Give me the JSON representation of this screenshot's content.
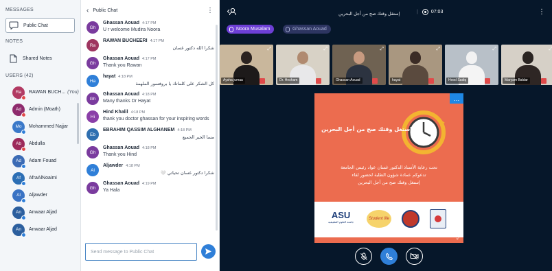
{
  "sidebar": {
    "messages_title": "MESSAGES",
    "public_chat_label": "Public Chat",
    "notes_title": "NOTES",
    "shared_notes_label": "Shared Notes",
    "users_title": "USERS (42)",
    "users": [
      {
        "initials": "Ra",
        "name": "RAWAN BUCH...",
        "suffix": "(You)",
        "color": "#b23a63",
        "badge": "#e04a4a"
      },
      {
        "initials": "Ad",
        "name": "Admin (Moath)",
        "suffix": "",
        "color": "#8e2b6d",
        "badge": "#e04a4a"
      },
      {
        "initials": "Mo",
        "name": "Mohammed Najjar",
        "suffix": "",
        "color": "#3b79c9",
        "badge": "#2f7fd8"
      },
      {
        "initials": "Ab",
        "name": "Abdulla",
        "suffix": "",
        "color": "#9d2a5b",
        "badge": "#e04a4a"
      },
      {
        "initials": "Ad",
        "name": "Adam Fouad",
        "suffix": "",
        "color": "#3b6bb5",
        "badge": "#2f7fd8"
      },
      {
        "initials": "Af",
        "name": "AfraAlNoaimi",
        "suffix": "",
        "color": "#2c6fb5",
        "badge": "#2f7fd8"
      },
      {
        "initials": "Al",
        "name": "Aljawder",
        "suffix": "",
        "color": "#3a73c4",
        "badge": "#2f7fd8"
      },
      {
        "initials": "An",
        "name": "Anwaar Aljad",
        "suffix": "",
        "color": "#2c5f9e",
        "badge": "#2f7fd8"
      },
      {
        "initials": "An",
        "name": "Anwaar Aljad",
        "suffix": "",
        "color": "#2c5f9e",
        "badge": "#2f7fd8"
      }
    ]
  },
  "chat": {
    "title": "Public Chat",
    "input_placeholder": "Send message to Public Chat",
    "messages": [
      {
        "initials": "Gh",
        "color": "#7a3b9e",
        "name": "Ghassan Aouad",
        "time": "4:17 PM",
        "text": "U r welcome Mudira Noora",
        "rtl": false
      },
      {
        "initials": "Ra",
        "color": "#9e3560",
        "name": "RAWAN BUCHEERI",
        "time": "4:17 PM",
        "text": "شكرا الله دكتور غسان",
        "rtl": true
      },
      {
        "initials": "Gh",
        "color": "#7a3b9e",
        "name": "Ghassan Aouad",
        "time": "4:17 PM",
        "text": "Thank you Rawan",
        "rtl": false
      },
      {
        "initials": "Ha",
        "color": "#2f7fd8",
        "name": "hayat",
        "time": "4:18 PM",
        "text": "كل الشكر على كلماتك يا بروفسور الملهمة",
        "rtl": true
      },
      {
        "initials": "Gh",
        "color": "#7a3b9e",
        "name": "Ghassan Aouad",
        "time": "4:18 PM",
        "text": "Many thanks Dr Hayat",
        "rtl": false
      },
      {
        "initials": "Hi",
        "color": "#8a3fa8",
        "name": "Hind Khalil",
        "time": "4:18 PM",
        "text": "thank you doctor ghassan for your inspiring words",
        "rtl": false
      },
      {
        "initials": "Eb",
        "color": "#2f6fb0",
        "name": "EBRAHIM QASSIM ALGHANEM",
        "time": "4:18 PM",
        "text": "مسا الخير الجميع",
        "rtl": true
      },
      {
        "initials": "Gh",
        "color": "#7a3b9e",
        "name": "Ghassan Aouad",
        "time": "4:18 PM",
        "text": "Thank you Hind",
        "rtl": false
      },
      {
        "initials": "Al",
        "color": "#2f7fd8",
        "name": "Aljawder",
        "time": "4:18 PM",
        "text": "شكرا دكتور غسان تحياتي 🤍",
        "rtl": true
      },
      {
        "initials": "Gh",
        "color": "#7a3b9e",
        "name": "Ghassan Aouad",
        "time": "4:19 PM",
        "text": "Ya Hala",
        "rtl": false
      }
    ]
  },
  "main": {
    "meeting_title": "إستقل وقتك صح من أجل البحرين",
    "recording_time": "07:03",
    "talking": [
      {
        "name": "Noora Musalam",
        "color": "#7c3aed"
      },
      {
        "name": "Ghassan Aouad",
        "color": "#3a3f6e"
      }
    ],
    "videos": [
      {
        "label": "Aysha jumaa",
        "bg": "#c9b79c",
        "head": "#2b2320",
        "body": "#1d1a1a"
      },
      {
        "label": "Dr. Hesham",
        "bg": "#d8d2c6",
        "head": "#b08a70",
        "body": "#e8e8ea"
      },
      {
        "label": "Ghassan Aouad",
        "bg": "#6f6252",
        "head": "#c79a80",
        "body": "#2c3340"
      },
      {
        "label": "hayat",
        "bg": "#a99780",
        "head": "#3b2c26",
        "body": "#5a4a3e"
      },
      {
        "label": "Hood Sadiq",
        "bg": "#b8c0c8",
        "head": "#f2f2f2",
        "body": "#f4f4f4"
      },
      {
        "label": "Maryam Baldar",
        "bg": "#d6d0c7",
        "head": "#2a2422",
        "body": "#2e2624"
      }
    ],
    "slide": {
      "headline": "إستغل وقتك صح من أجل البحرين",
      "body_line1": "تحت رعاية الأستاذ الدكتور غسان عواد رئيس الجامعة",
      "body_line2": "تدعوكم عمادة شؤون الطلبة لحضور لقاء",
      "body_line3": "إستغل وقتك صح من أجل البحرين",
      "logo_asu": "ASU",
      "logo_asu_sub": "جامعة العلوم التطبيقية",
      "logo_studentlife": "Student life"
    }
  }
}
